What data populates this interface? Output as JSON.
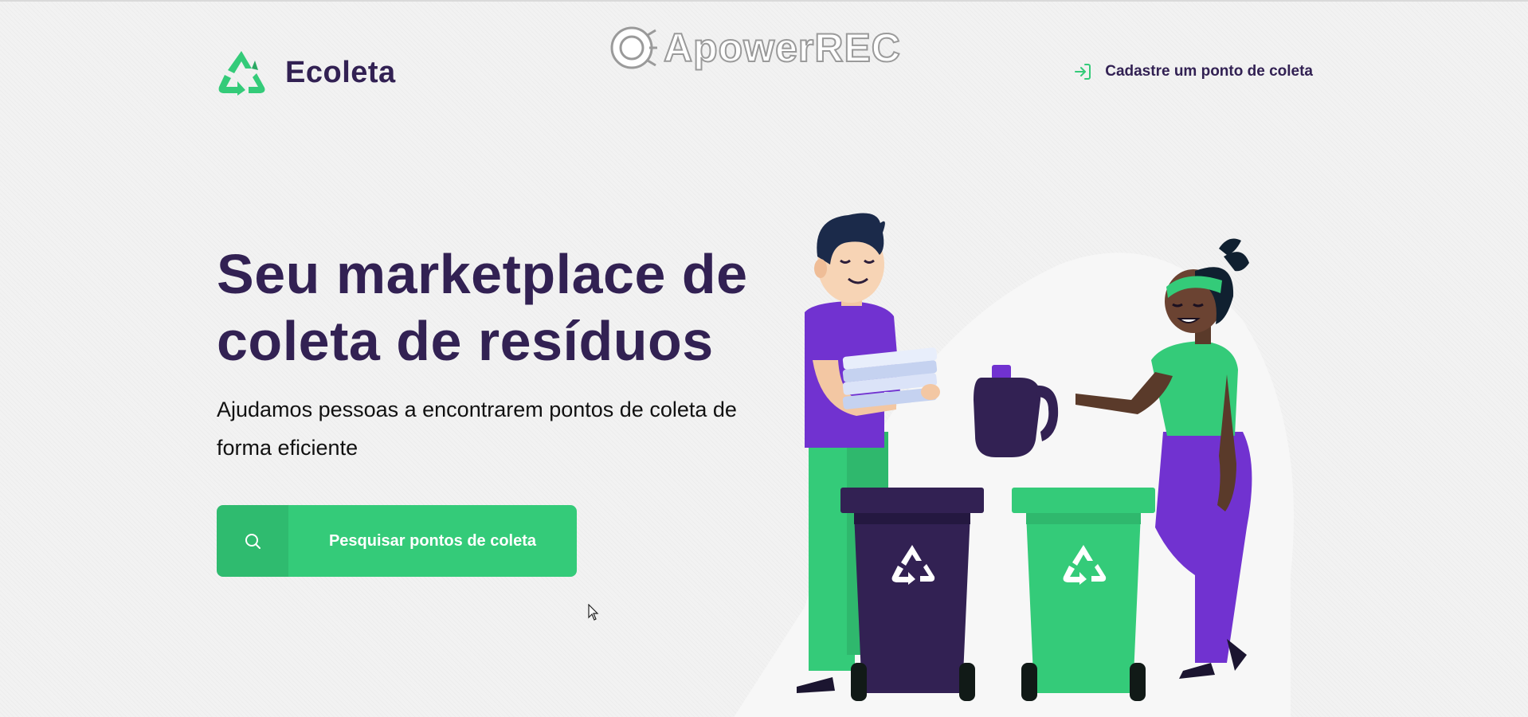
{
  "header": {
    "logo_text": "Ecoleta",
    "register_link_label": "Cadastre um ponto de coleta"
  },
  "watermark": {
    "text": "ApowerREC"
  },
  "hero": {
    "title": "Seu marketplace de coleta de resíduos",
    "description": "Ajudamos pessoas a encontrarem pontos de coleta de forma eficiente",
    "search_button_label": "Pesquisar pontos de coleta"
  },
  "icons": {
    "logo": "recycle-icon",
    "register_link": "log-in-icon",
    "search": "search-icon",
    "cursor": "mouse-pointer-icon"
  },
  "colors": {
    "brand_green": "#34cb79",
    "brand_dark": "#322153",
    "purple": "#7132d0",
    "background": "#f2f2f2"
  }
}
